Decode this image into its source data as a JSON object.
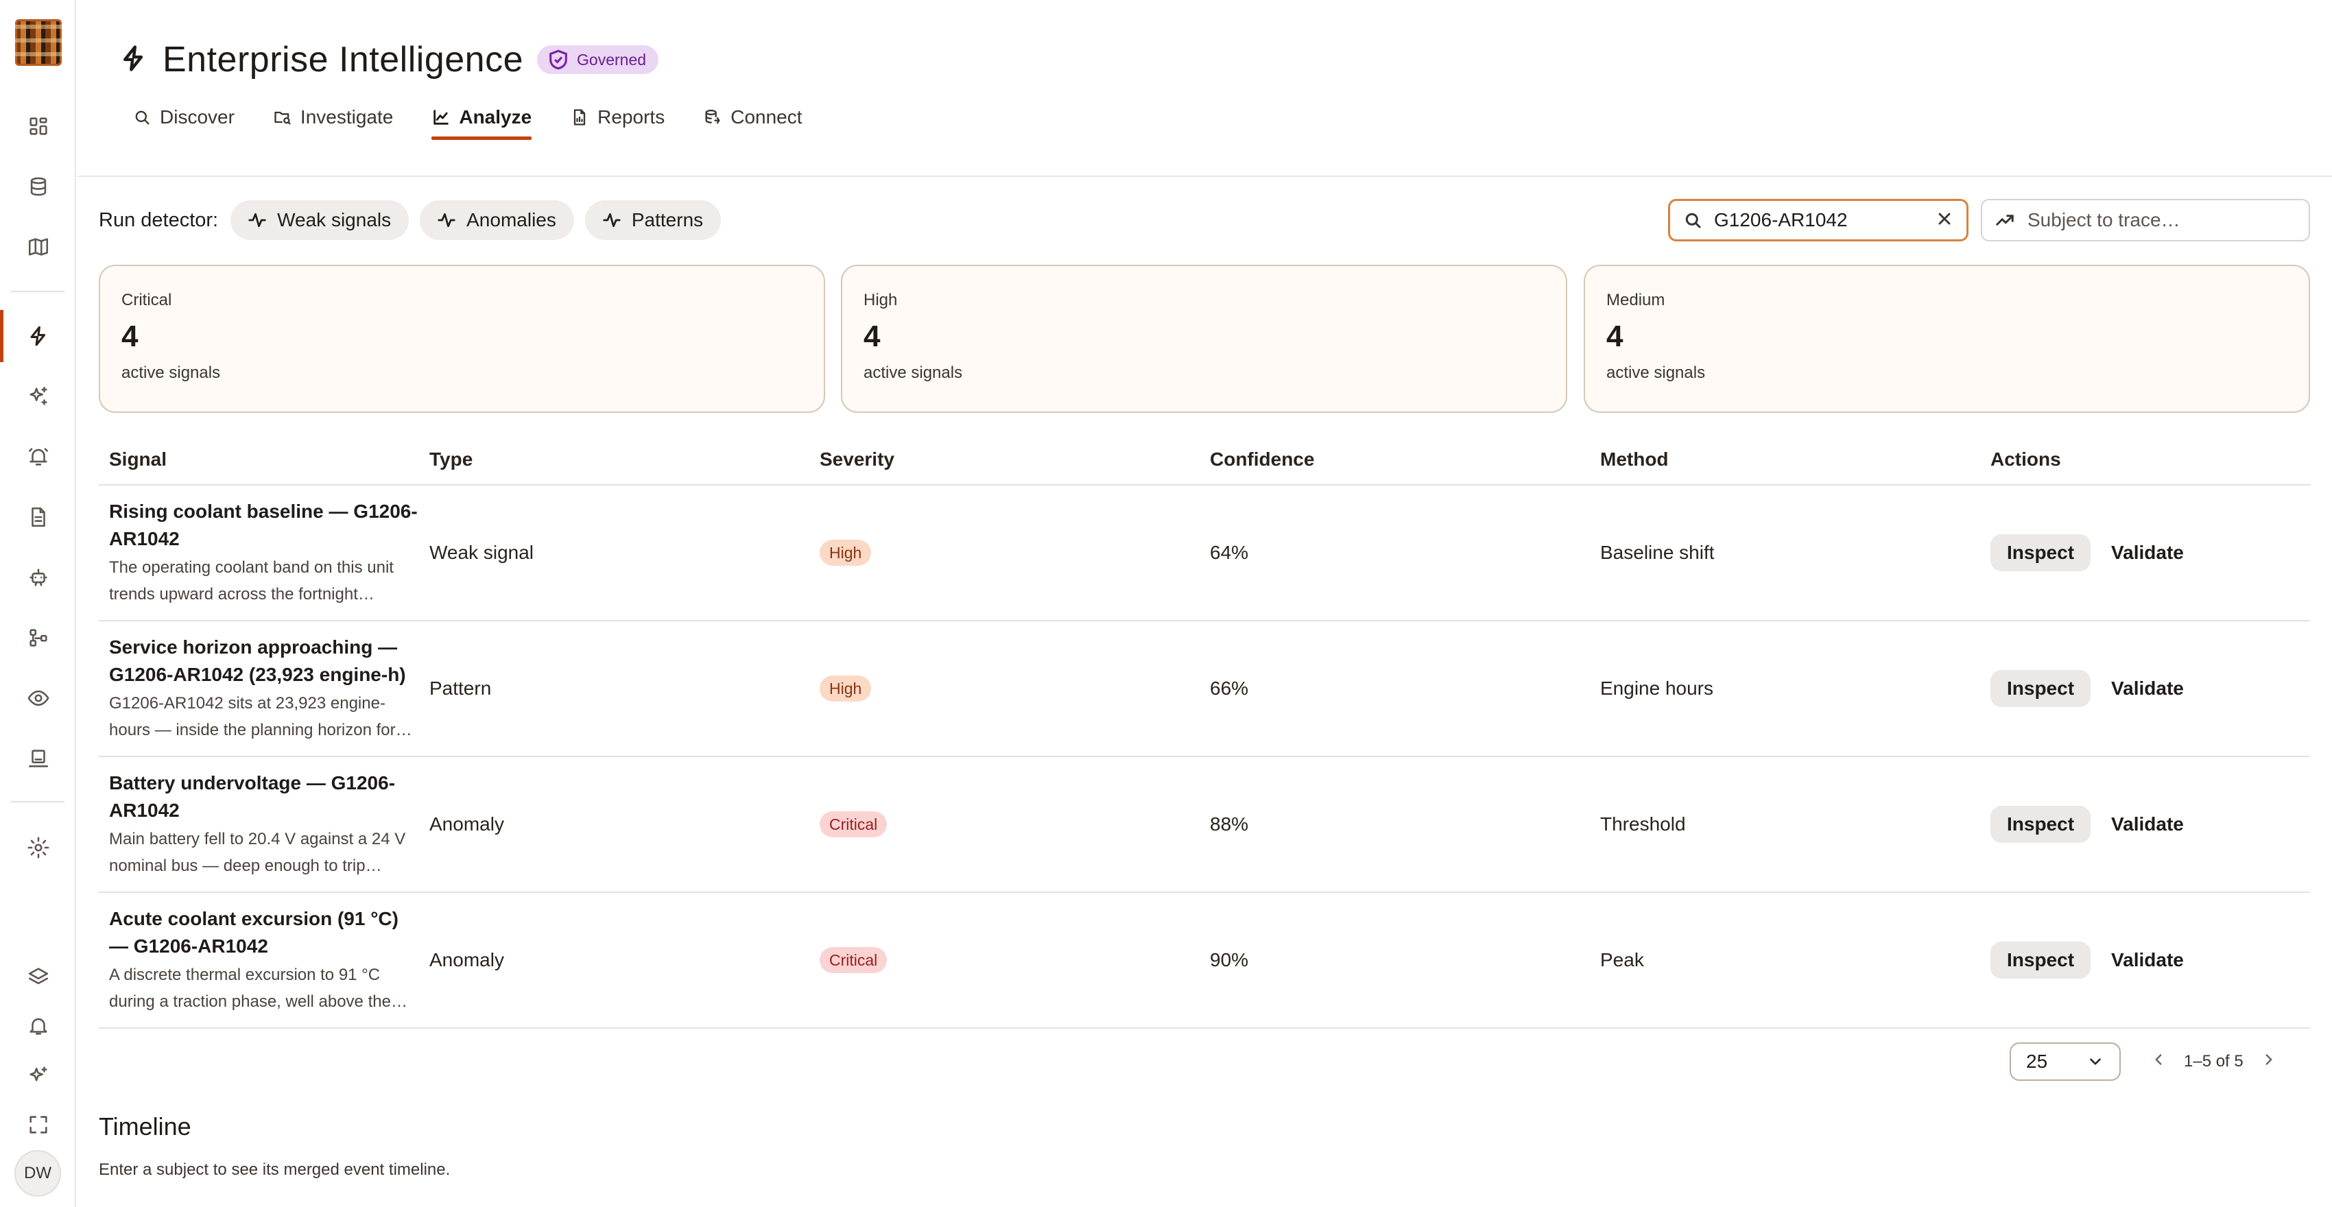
{
  "sidebar": {
    "user_initials": "DW",
    "active_index": 4
  },
  "header": {
    "title": "Enterprise Intelligence",
    "badge": "Governed",
    "tabs": [
      {
        "label": "Discover",
        "icon": "search-icon"
      },
      {
        "label": "Investigate",
        "icon": "folder-search-icon"
      },
      {
        "label": "Analyze",
        "icon": "chart-line-icon",
        "active": true
      },
      {
        "label": "Reports",
        "icon": "file-chart-icon"
      },
      {
        "label": "Connect",
        "icon": "database-link-icon"
      }
    ]
  },
  "toolbar": {
    "run_label": "Run detector:",
    "detectors": [
      "Weak signals",
      "Anomalies",
      "Patterns"
    ],
    "search_value": "G1206-AR1042",
    "trace_placeholder": "Subject to trace…"
  },
  "cards": [
    {
      "label": "Critical",
      "count": "4",
      "sub": "active signals"
    },
    {
      "label": "High",
      "count": "4",
      "sub": "active signals"
    },
    {
      "label": "Medium",
      "count": "4",
      "sub": "active signals"
    }
  ],
  "table": {
    "columns": [
      "Signal",
      "Type",
      "Severity",
      "Confidence",
      "Method",
      "Actions"
    ],
    "rows": [
      {
        "title": "Rising coolant baseline — G1206-AR1042",
        "desc": "The operating coolant band on this unit trends upward across the fortnight window, suggesting gradual cooling degradation.",
        "type": "Weak signal",
        "severity": "High",
        "confidence": "64%",
        "method": "Baseline shift"
      },
      {
        "title": "Service horizon approaching — G1206-AR1042 (23,923 engine-h)",
        "desc": "G1206-AR1042 sits at 23,923 engine-hours — inside the planning horizon for the next major service interval.",
        "type": "Pattern",
        "severity": "High",
        "confidence": "66%",
        "method": "Engine hours"
      },
      {
        "title": "Battery undervoltage — G1206-AR1042",
        "desc": "Main battery fell to 20.4 V against a 24 V nominal bus — deep enough to trip starting and control circuits.",
        "type": "Anomaly",
        "severity": "Critical",
        "confidence": "88%",
        "method": "Threshold"
      },
      {
        "title": "Acute coolant excursion (91 °C) — G1206-AR1042",
        "desc": "A discrete thermal excursion to 91 °C during a traction phase, well above the expected operating envelope.",
        "type": "Anomaly",
        "severity": "Critical",
        "confidence": "90%",
        "method": "Peak"
      }
    ],
    "inspect_label": "Inspect",
    "validate_label": "Validate"
  },
  "pagination": {
    "page_size": "25",
    "range": "1–5 of 5"
  },
  "timeline": {
    "title": "Timeline",
    "desc": "Enter a subject to see its merged event timeline."
  },
  "colors": {
    "accent": "#c2410c",
    "governed_badge_bg": "#ead7f3",
    "high_badge_bg": "#fbd9c4",
    "critical_badge_bg": "#fbd3d3"
  }
}
